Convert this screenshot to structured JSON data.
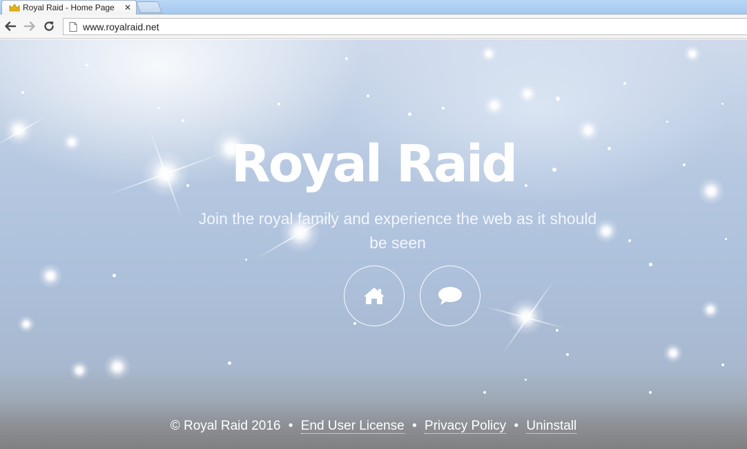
{
  "browser": {
    "tab": {
      "title": "Royal Raid - Home Page",
      "close_glyph": "✕"
    },
    "address_bar": {
      "url": "www.royalraid.net"
    }
  },
  "hero": {
    "title": "Royal Raid",
    "tagline": "Join the royal family and experience the web as it should be seen",
    "buttons": [
      {
        "icon": "home-icon"
      },
      {
        "icon": "chat-bubble-icon"
      }
    ]
  },
  "footer": {
    "copyright": "© Royal Raid 2016",
    "separator": "•",
    "links": [
      {
        "label": "End User License"
      },
      {
        "label": "Privacy Policy"
      },
      {
        "label": "Uninstall"
      }
    ]
  },
  "colors": {
    "favicon_crown": "#e3b418",
    "text_white": "#ffffff"
  }
}
